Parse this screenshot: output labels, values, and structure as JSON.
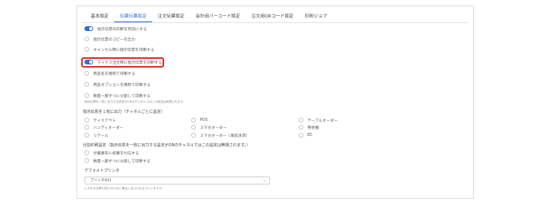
{
  "tabs": [
    "基本設定",
    "伝票伝票設定",
    "注文伝票設定",
    "会計用バーコード設定",
    "注文用QRコード設定",
    "印刷ジョブ"
  ],
  "active_tab_index": 1,
  "top_options": [
    {
      "type": "toggle",
      "label": "指示伝票の印刷を有効にする"
    },
    {
      "type": "radio",
      "label": "指示伝票のコピーを出力"
    },
    {
      "type": "radio",
      "label": "キャンセル時に指示伝票を印刷する"
    },
    {
      "type": "toggle",
      "label": "マイナス注文時に指示伝票を印刷する",
      "highlighted": true
    },
    {
      "type": "radio",
      "label": "商品名を略称で印刷する"
    },
    {
      "type": "radio",
      "label": "商品オプションを略称で印刷する"
    },
    {
      "type": "radio",
      "label": "数量一部ずつに分割して印刷する"
    }
  ],
  "note1": "指示伝票を一枚に出力する設定がONのチャネルではこの設定は無視されます。",
  "section1_title": "指示伝票を１枚に出力（チャネルごとに設定）",
  "channels": [
    "テイクアウト",
    "POS",
    "テーブルオーダー",
    "ハンディオーダー",
    "スマホオーダー",
    "券売機",
    "リテール",
    "スマホオーダー（事前決済）",
    "EC"
  ],
  "section2_title": "分割印刷設定（指示伝票を一枚に出力する設定がONのチャネルではこの設定は無視されます。）",
  "split_options": [
    "付属番号に枝番を付与する",
    "数量一部ずつに分割して印刷する"
  ],
  "printer_label": "デフォルトプリンタ",
  "printer_value": "プリンタ001",
  "printer_note": "いずれの伝票も振り分けない場合に出力されるプリンタです。"
}
